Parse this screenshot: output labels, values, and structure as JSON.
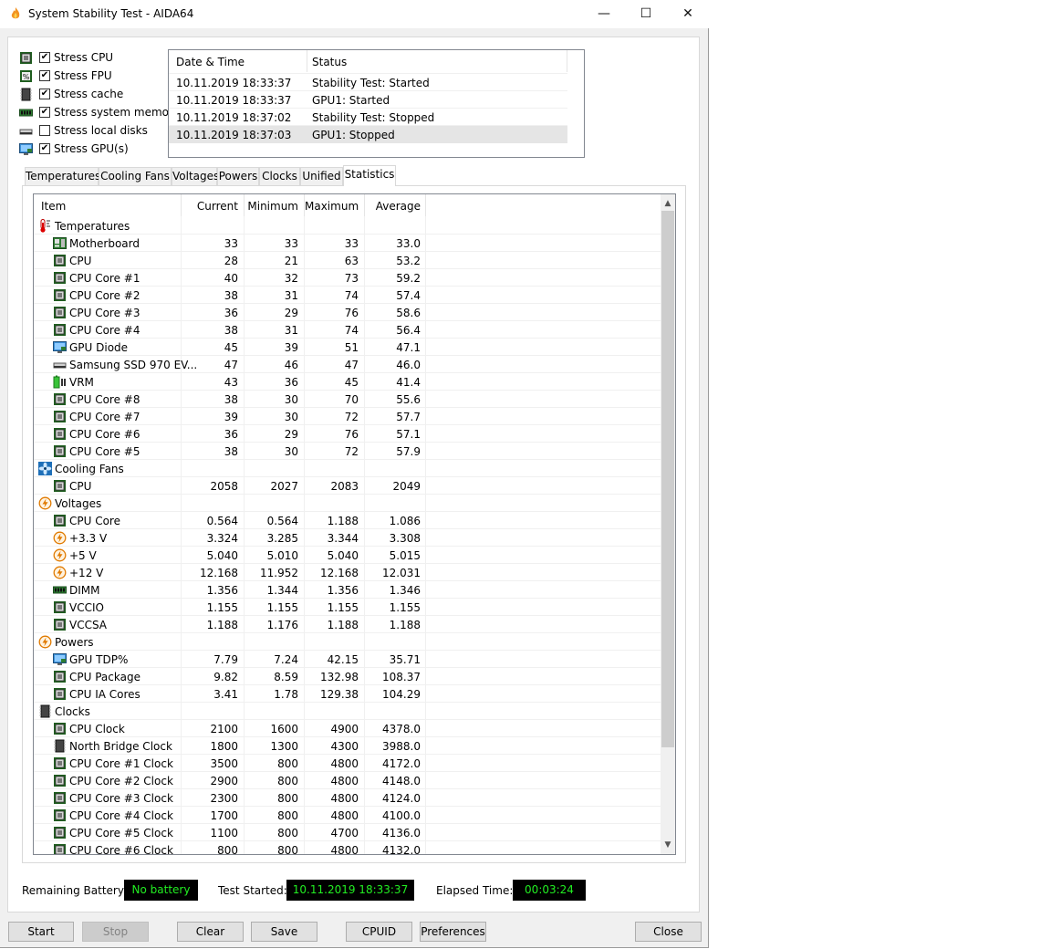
{
  "window": {
    "title": "System Stability Test - AIDA64",
    "minimize": "—",
    "maximize": "☐",
    "close": "✕"
  },
  "stress_options": [
    {
      "label": "Stress CPU",
      "checked": true,
      "icon": "cpu-icon"
    },
    {
      "label": "Stress FPU",
      "checked": true,
      "icon": "fpu-icon"
    },
    {
      "label": "Stress cache",
      "checked": true,
      "icon": "cache-icon"
    },
    {
      "label": "Stress system memory",
      "checked": true,
      "icon": "memory-icon"
    },
    {
      "label": "Stress local disks",
      "checked": false,
      "icon": "disk-icon"
    },
    {
      "label": "Stress GPU(s)",
      "checked": true,
      "icon": "gpu-icon"
    }
  ],
  "log": {
    "headers": [
      "Date & Time",
      "Status"
    ],
    "rows": [
      {
        "time": "10.11.2019 18:33:37",
        "status": "Stability Test: Started"
      },
      {
        "time": "10.11.2019 18:33:37",
        "status": "GPU1: Started"
      },
      {
        "time": "10.11.2019 18:37:02",
        "status": "Stability Test: Stopped"
      },
      {
        "time": "10.11.2019 18:37:03",
        "status": "GPU1: Stopped"
      }
    ]
  },
  "tabs": [
    "Temperatures",
    "Cooling Fans",
    "Voltages",
    "Powers",
    "Clocks",
    "Unified",
    "Statistics"
  ],
  "active_tab": "Statistics",
  "stats": {
    "headers": [
      "Item",
      "Current",
      "Minimum",
      "Maximum",
      "Average"
    ],
    "rows": [
      {
        "group": true,
        "name": "Temperatures",
        "icon": "thermometer-icon"
      },
      {
        "name": "Motherboard",
        "icon": "motherboard-icon",
        "cur": "33",
        "min": "33",
        "max": "33",
        "avg": "33.0"
      },
      {
        "name": "CPU",
        "icon": "cpu-icon",
        "cur": "28",
        "min": "21",
        "max": "63",
        "avg": "53.2"
      },
      {
        "name": "CPU Core #1",
        "icon": "cpu-icon",
        "cur": "40",
        "min": "32",
        "max": "73",
        "avg": "59.2"
      },
      {
        "name": "CPU Core #2",
        "icon": "cpu-icon",
        "cur": "38",
        "min": "31",
        "max": "74",
        "avg": "57.4"
      },
      {
        "name": "CPU Core #3",
        "icon": "cpu-icon",
        "cur": "36",
        "min": "29",
        "max": "76",
        "avg": "58.6"
      },
      {
        "name": "CPU Core #4",
        "icon": "cpu-icon",
        "cur": "38",
        "min": "31",
        "max": "74",
        "avg": "56.4"
      },
      {
        "name": "GPU Diode",
        "icon": "gpu-icon",
        "cur": "45",
        "min": "39",
        "max": "51",
        "avg": "47.1"
      },
      {
        "name": "Samsung SSD 970 EV...",
        "icon": "disk-icon",
        "cur": "47",
        "min": "46",
        "max": "47",
        "avg": "46.0"
      },
      {
        "name": "VRM",
        "icon": "battery-icon",
        "cur": "43",
        "min": "36",
        "max": "45",
        "avg": "41.4"
      },
      {
        "name": "CPU Core #8",
        "icon": "cpu-icon",
        "cur": "38",
        "min": "30",
        "max": "70",
        "avg": "55.6"
      },
      {
        "name": "CPU Core #7",
        "icon": "cpu-icon",
        "cur": "39",
        "min": "30",
        "max": "72",
        "avg": "57.7"
      },
      {
        "name": "CPU Core #6",
        "icon": "cpu-icon",
        "cur": "36",
        "min": "29",
        "max": "76",
        "avg": "57.1"
      },
      {
        "name": "CPU Core #5",
        "icon": "cpu-icon",
        "cur": "38",
        "min": "30",
        "max": "72",
        "avg": "57.9"
      },
      {
        "group": true,
        "name": "Cooling Fans",
        "icon": "fan-icon"
      },
      {
        "name": "CPU",
        "icon": "cpu-icon",
        "cur": "2058",
        "min": "2027",
        "max": "2083",
        "avg": "2049"
      },
      {
        "group": true,
        "name": "Voltages",
        "icon": "voltage-icon"
      },
      {
        "name": "CPU Core",
        "icon": "cpu-icon",
        "cur": "0.564",
        "min": "0.564",
        "max": "1.188",
        "avg": "1.086"
      },
      {
        "name": "+3.3 V",
        "icon": "voltage-icon",
        "cur": "3.324",
        "min": "3.285",
        "max": "3.344",
        "avg": "3.308"
      },
      {
        "name": "+5 V",
        "icon": "voltage-icon",
        "cur": "5.040",
        "min": "5.010",
        "max": "5.040",
        "avg": "5.015"
      },
      {
        "name": "+12 V",
        "icon": "voltage-icon",
        "cur": "12.168",
        "min": "11.952",
        "max": "12.168",
        "avg": "12.031"
      },
      {
        "name": "DIMM",
        "icon": "memory-icon",
        "cur": "1.356",
        "min": "1.344",
        "max": "1.356",
        "avg": "1.346"
      },
      {
        "name": "VCCIO",
        "icon": "cpu-icon",
        "cur": "1.155",
        "min": "1.155",
        "max": "1.155",
        "avg": "1.155"
      },
      {
        "name": "VCCSA",
        "icon": "cpu-icon",
        "cur": "1.188",
        "min": "1.176",
        "max": "1.188",
        "avg": "1.188"
      },
      {
        "group": true,
        "name": "Powers",
        "icon": "voltage-icon"
      },
      {
        "name": "GPU TDP%",
        "icon": "gpu-icon",
        "cur": "7.79",
        "min": "7.24",
        "max": "42.15",
        "avg": "35.71"
      },
      {
        "name": "CPU Package",
        "icon": "cpu-icon",
        "cur": "9.82",
        "min": "8.59",
        "max": "132.98",
        "avg": "108.37"
      },
      {
        "name": "CPU IA Cores",
        "icon": "cpu-icon",
        "cur": "3.41",
        "min": "1.78",
        "max": "129.38",
        "avg": "104.29"
      },
      {
        "group": true,
        "name": "Clocks",
        "icon": "cache-icon"
      },
      {
        "name": "CPU Clock",
        "icon": "cpu-icon",
        "cur": "2100",
        "min": "1600",
        "max": "4900",
        "avg": "4378.0"
      },
      {
        "name": "North Bridge Clock",
        "icon": "cache-icon",
        "cur": "1800",
        "min": "1300",
        "max": "4300",
        "avg": "3988.0"
      },
      {
        "name": "CPU Core #1 Clock",
        "icon": "cpu-icon",
        "cur": "3500",
        "min": "800",
        "max": "4800",
        "avg": "4172.0"
      },
      {
        "name": "CPU Core #2 Clock",
        "icon": "cpu-icon",
        "cur": "2900",
        "min": "800",
        "max": "4800",
        "avg": "4148.0"
      },
      {
        "name": "CPU Core #3 Clock",
        "icon": "cpu-icon",
        "cur": "2300",
        "min": "800",
        "max": "4800",
        "avg": "4124.0"
      },
      {
        "name": "CPU Core #4 Clock",
        "icon": "cpu-icon",
        "cur": "1700",
        "min": "800",
        "max": "4800",
        "avg": "4100.0"
      },
      {
        "name": "CPU Core #5 Clock",
        "icon": "cpu-icon",
        "cur": "1100",
        "min": "800",
        "max": "4700",
        "avg": "4136.0"
      },
      {
        "name": "CPU Core #6 Clock",
        "icon": "cpu-icon",
        "cur": "800",
        "min": "800",
        "max": "4800",
        "avg": "4132.0"
      }
    ]
  },
  "status_bar": {
    "battery_label": "Remaining Battery:",
    "battery_value": "No battery",
    "started_label": "Test Started:",
    "started_value": "10.11.2019 18:33:37",
    "elapsed_label": "Elapsed Time:",
    "elapsed_value": "00:03:24"
  },
  "buttons": {
    "start": "Start",
    "stop": "Stop",
    "clear": "Clear",
    "save": "Save",
    "cpuid": "CPUID",
    "preferences": "Preferences",
    "close": "Close"
  },
  "colors": {
    "lcd_text": "#22ee22",
    "lcd_bg": "#000000",
    "selected_row": "#e5e5e5"
  }
}
